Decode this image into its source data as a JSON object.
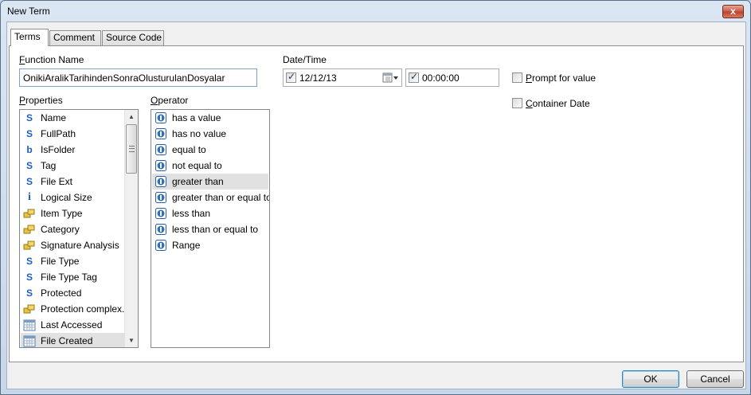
{
  "window": {
    "title": "New Term",
    "close_glyph": "x"
  },
  "tabs": [
    {
      "label": "Terms",
      "active": true
    },
    {
      "label": "Comment",
      "active": false
    },
    {
      "label": "Source Code",
      "active": false
    }
  ],
  "function_name": {
    "label_first": "F",
    "label_rest": "unction Name",
    "value": "OnikiAralikTarihindenSonraOlusturulanDosyalar"
  },
  "date_time": {
    "label": "Date/Time",
    "date_checked": true,
    "date_value": "12/12/13",
    "time_checked": true,
    "time_value": "00:00:00"
  },
  "options": {
    "prompt": {
      "label_first": "P",
      "label_rest": "rompt for value",
      "checked": false
    },
    "container": {
      "label_first": "C",
      "label_rest": "ontainer Date",
      "checked": false
    }
  },
  "properties": {
    "label_first": "P",
    "label_rest": "roperties",
    "items": [
      {
        "label": "Name",
        "icon": "s"
      },
      {
        "label": "FullPath",
        "icon": "s"
      },
      {
        "label": "IsFolder",
        "icon": "b"
      },
      {
        "label": "Tag",
        "icon": "s"
      },
      {
        "label": "File Ext",
        "icon": "s"
      },
      {
        "label": "Logical Size",
        "icon": "i"
      },
      {
        "label": "Item Type",
        "icon": "link"
      },
      {
        "label": "Category",
        "icon": "link"
      },
      {
        "label": "Signature Analysis",
        "icon": "link"
      },
      {
        "label": "File Type",
        "icon": "s"
      },
      {
        "label": "File Type Tag",
        "icon": "s"
      },
      {
        "label": "Protected",
        "icon": "s"
      },
      {
        "label": "Protection complex...",
        "icon": "link"
      },
      {
        "label": "Last Accessed",
        "icon": "calendar"
      },
      {
        "label": "File Created",
        "icon": "calendar",
        "selected": true
      }
    ]
  },
  "operator": {
    "label_first": "O",
    "label_rest": "perator",
    "items": [
      {
        "label": "has a value"
      },
      {
        "label": "has no value"
      },
      {
        "label": "equal to"
      },
      {
        "label": "not equal to"
      },
      {
        "label": "greater than",
        "selected": true
      },
      {
        "label": "greater than or equal to"
      },
      {
        "label": "less than"
      },
      {
        "label": "less than or equal to"
      },
      {
        "label": "Range"
      }
    ]
  },
  "buttons": {
    "ok": "OK",
    "cancel": "Cancel"
  },
  "colors": {
    "accent": "#1f5fb8",
    "selection": "#e1e1e1",
    "link_icon": "#d9a520"
  }
}
